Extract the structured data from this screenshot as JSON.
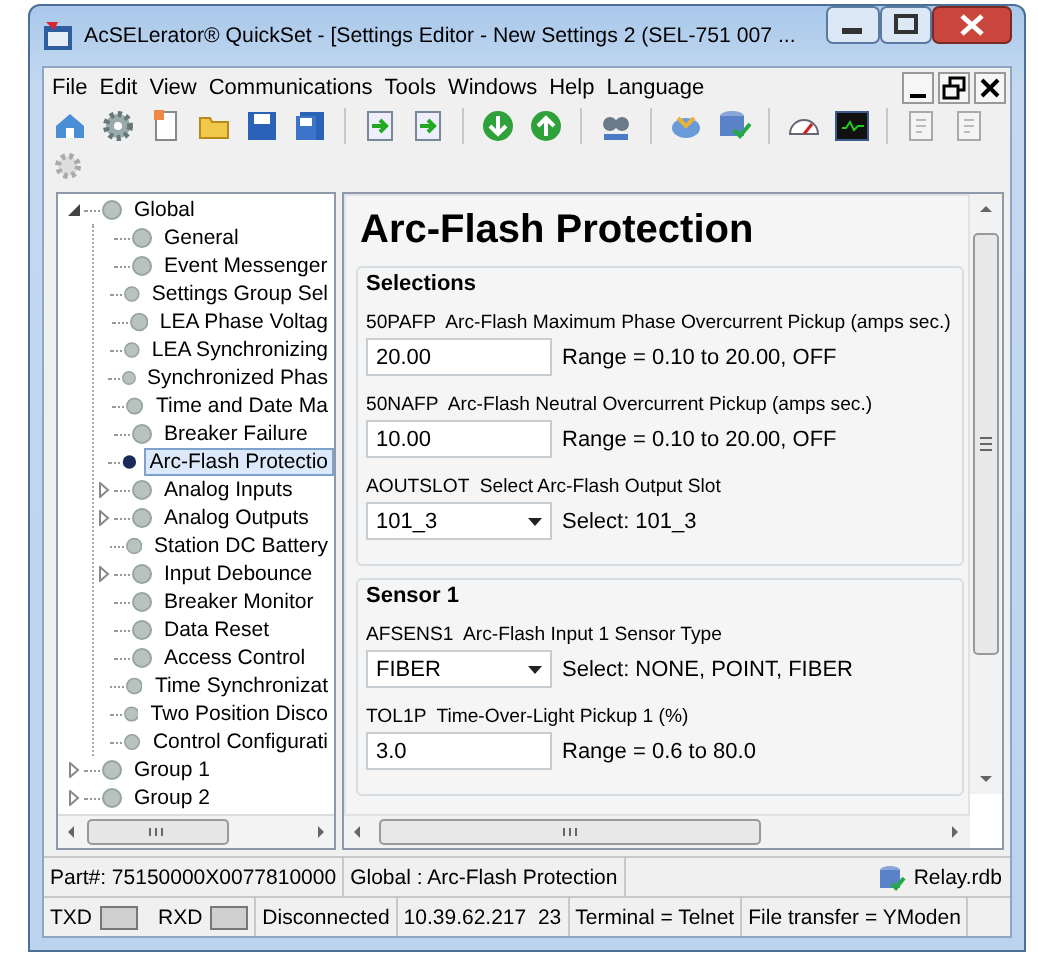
{
  "window": {
    "title": "AcSELerator® QuickSet - [Settings Editor - New Settings 2 (SEL-751 007 ..."
  },
  "menu": [
    "File",
    "Edit",
    "View",
    "Communications",
    "Tools",
    "Windows",
    "Help",
    "Language"
  ],
  "tree": [
    {
      "label": "Global",
      "kind": "folder",
      "expanded": true,
      "selected": false,
      "children": [
        {
          "label": "General",
          "kind": "leaf",
          "selected": false
        },
        {
          "label": "Event Messenger",
          "kind": "leaf",
          "selected": false
        },
        {
          "label": "Settings Group Sel",
          "kind": "leaf",
          "selected": false
        },
        {
          "label": "LEA Phase Voltag",
          "kind": "leaf",
          "selected": false
        },
        {
          "label": "LEA Synchronizing",
          "kind": "leaf",
          "selected": false
        },
        {
          "label": "Synchronized Phas",
          "kind": "leaf",
          "selected": false
        },
        {
          "label": "Time and Date Ma",
          "kind": "leaf",
          "selected": false
        },
        {
          "label": "Breaker Failure",
          "kind": "leaf",
          "selected": false
        },
        {
          "label": "Arc-Flash Protectio",
          "kind": "leaf",
          "selected": true
        },
        {
          "label": "Analog Inputs",
          "kind": "folder",
          "expanded": false,
          "selected": false
        },
        {
          "label": "Analog Outputs",
          "kind": "folder",
          "expanded": false,
          "selected": false
        },
        {
          "label": "Station DC Battery",
          "kind": "leaf",
          "selected": false
        },
        {
          "label": "Input Debounce",
          "kind": "folder",
          "expanded": false,
          "selected": false
        },
        {
          "label": "Breaker Monitor",
          "kind": "leaf",
          "selected": false
        },
        {
          "label": "Data Reset",
          "kind": "leaf",
          "selected": false
        },
        {
          "label": "Access Control",
          "kind": "leaf",
          "selected": false
        },
        {
          "label": "Time Synchronizat",
          "kind": "leaf",
          "selected": false
        },
        {
          "label": "Two Position Disco",
          "kind": "leaf",
          "selected": false
        },
        {
          "label": "Control Configurati",
          "kind": "leaf",
          "selected": false
        }
      ]
    },
    {
      "label": "Group 1",
      "kind": "folder",
      "expanded": false,
      "selected": false
    },
    {
      "label": "Group 2",
      "kind": "folder",
      "expanded": false,
      "selected": false
    }
  ],
  "editor": {
    "title": "Arc-Flash Protection",
    "groups": [
      {
        "title": "Selections",
        "settings": [
          {
            "code": "50PAFP",
            "description": "Arc-Flash Maximum Phase Overcurrent Pickup (amps sec.)",
            "kind": "text",
            "value": "20.00",
            "hint": "Range = 0.10 to 20.00, OFF"
          },
          {
            "code": "50NAFP",
            "description": "Arc-Flash Neutral Overcurrent Pickup (amps sec.)",
            "kind": "text",
            "value": "10.00",
            "hint": "Range = 0.10 to 20.00, OFF"
          },
          {
            "code": "AOUTSLOT",
            "description": "Select Arc-Flash Output Slot",
            "kind": "select",
            "value": "101_3",
            "hint": "Select: 101_3"
          }
        ]
      },
      {
        "title": "Sensor 1",
        "settings": [
          {
            "code": "AFSENS1",
            "description": "Arc-Flash Input 1 Sensor Type",
            "kind": "select",
            "value": "FIBER",
            "hint": "Select: NONE, POINT, FIBER"
          },
          {
            "code": "TOL1P",
            "description": "Time-Over-Light Pickup 1 (%)",
            "kind": "text",
            "value": "3.0",
            "hint": "Range = 0.6 to 80.0"
          }
        ]
      }
    ]
  },
  "status_bar": {
    "part": "Part#: 75150000X0077810000",
    "location": "Global : Arc-Flash Protection",
    "file": "Relay.rdb"
  },
  "connection_bar": {
    "indicators": [
      {
        "label": "TXD",
        "lit": false
      },
      {
        "label": "RXD",
        "lit": false
      }
    ],
    "fields": [
      "Disconnected",
      "10.39.62.217  23",
      "Terminal = Telnet",
      "File transfer = YModen"
    ]
  }
}
